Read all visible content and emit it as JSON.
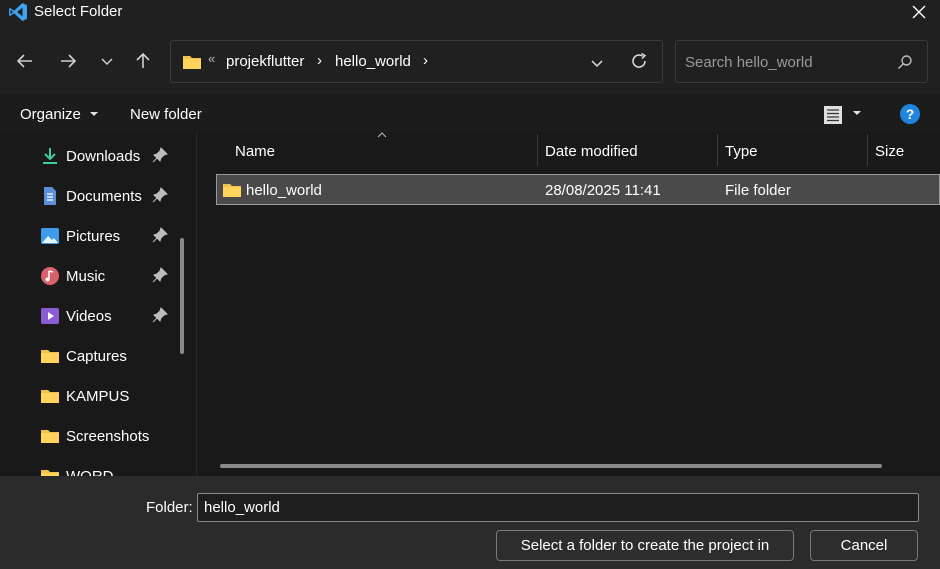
{
  "window": {
    "title": "Select Folder",
    "app_icon": "vscode-icon",
    "close_icon": "close-icon"
  },
  "nav": {
    "back_icon": "arrow-left-icon",
    "forward_icon": "arrow-right-icon",
    "recent_icon": "chevron-down-icon",
    "up_icon": "arrow-up-icon",
    "address": {
      "overflow": "«",
      "crumbs": [
        "projekflutter",
        "hello_world"
      ],
      "separator": "›"
    },
    "search_placeholder": "Search hello_world"
  },
  "toolbar": {
    "organize": "Organize",
    "new_folder": "New folder",
    "help": "?"
  },
  "sidebar": {
    "items": [
      {
        "label": "Downloads",
        "icon": "download-icon",
        "pinned": true
      },
      {
        "label": "Documents",
        "icon": "document-icon",
        "pinned": true
      },
      {
        "label": "Pictures",
        "icon": "pictures-icon",
        "pinned": true
      },
      {
        "label": "Music",
        "icon": "music-icon",
        "pinned": true
      },
      {
        "label": "Videos",
        "icon": "video-icon",
        "pinned": true
      },
      {
        "label": "Captures",
        "icon": "folder-icon",
        "pinned": false
      },
      {
        "label": "KAMPUS",
        "icon": "folder-icon",
        "pinned": false
      },
      {
        "label": "Screenshots",
        "icon": "folder-icon",
        "pinned": false
      },
      {
        "label": "WORD",
        "icon": "folder-icon",
        "pinned": false
      }
    ]
  },
  "files": {
    "columns": [
      "Name",
      "Date modified",
      "Type",
      "Size"
    ],
    "rows": [
      {
        "name": "hello_world",
        "date": "28/08/2025 11:41",
        "type": "File folder",
        "size": ""
      }
    ]
  },
  "footer": {
    "folder_label": "Folder:",
    "folder_value": "hello_world",
    "select_button": "Select a folder to create the project in",
    "cancel_button": "Cancel"
  },
  "colors": {
    "accent": "#1f86e0",
    "folder": "#f2c14e",
    "background": "#191919"
  }
}
